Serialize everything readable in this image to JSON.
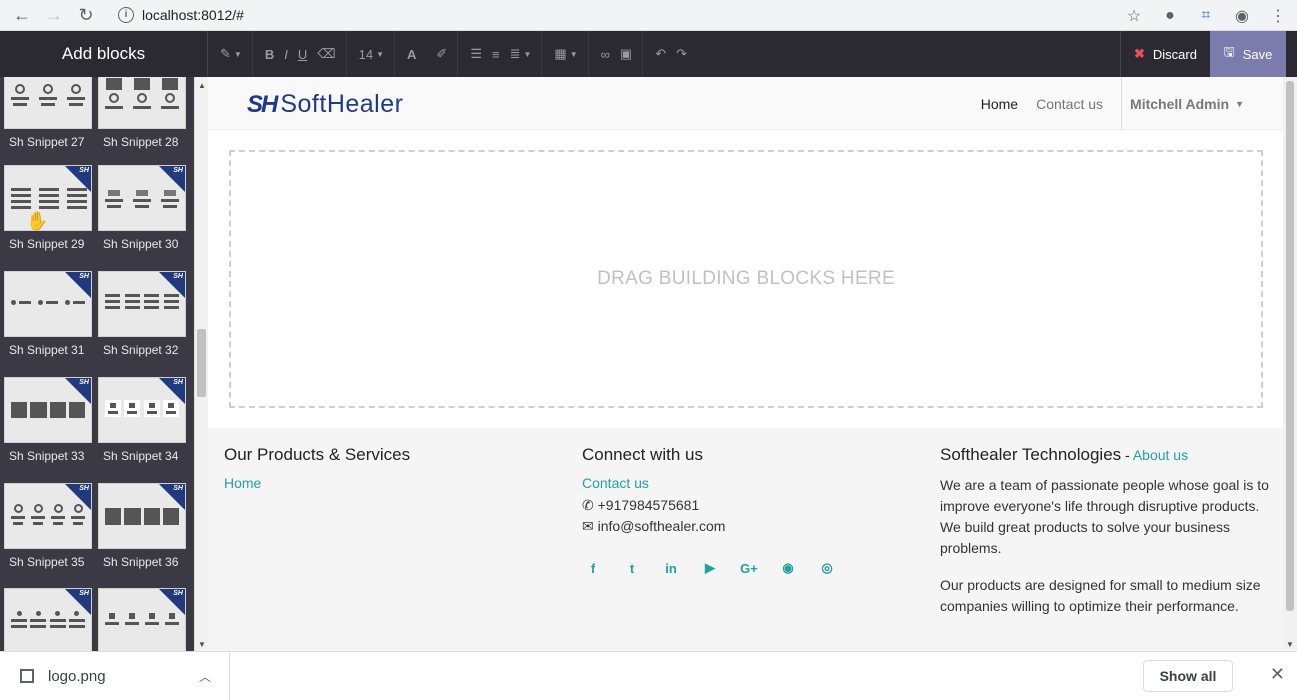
{
  "browser": {
    "url": "localhost:8012/#"
  },
  "toolbar": {
    "add_blocks": "Add blocks",
    "font_size": "14",
    "discard_label": "Discard",
    "save_label": "Save"
  },
  "sidebar": {
    "snippets": [
      {
        "label": "Sh Snippet 27"
      },
      {
        "label": "Sh Snippet 28"
      },
      {
        "label": "Sh Snippet 29"
      },
      {
        "label": "Sh Snippet 30"
      },
      {
        "label": "Sh Snippet 31"
      },
      {
        "label": "Sh Snippet 32"
      },
      {
        "label": "Sh Snippet 33"
      },
      {
        "label": "Sh Snippet 34"
      },
      {
        "label": "Sh Snippet 35"
      },
      {
        "label": "Sh Snippet 36"
      },
      {
        "label": ""
      },
      {
        "label": ""
      }
    ],
    "badge": "SH"
  },
  "header": {
    "logo_mark": "SH",
    "logo_text": "SoftHealer",
    "menu": {
      "home": "Home",
      "contact": "Contact us",
      "user": "Mitchell Admin"
    }
  },
  "dropzone": {
    "text": "DRAG BUILDING BLOCKS HERE"
  },
  "footer": {
    "col1": {
      "title": "Our Products & Services",
      "link": "Home"
    },
    "col2": {
      "title": "Connect with us",
      "link": "Contact us",
      "phone": "+917984575681",
      "email": "info@softhealer.com"
    },
    "col3": {
      "title": "Softhealer Technologies",
      "title_sep": " - ",
      "about": "About us",
      "p1": "We are a team of passionate people whose goal is to improve everyone's life through disruptive products. We build great products to solve your business problems.",
      "p2": "Our products are designed for small to medium size companies willing to optimize their performance."
    }
  },
  "downloads": {
    "file": "logo.png",
    "show_all": "Show all"
  },
  "colors": {
    "accent": "#20a39e",
    "save": "#7c7bad",
    "toolbar": "#2b2a33",
    "sidebar": "#3b3a44"
  }
}
